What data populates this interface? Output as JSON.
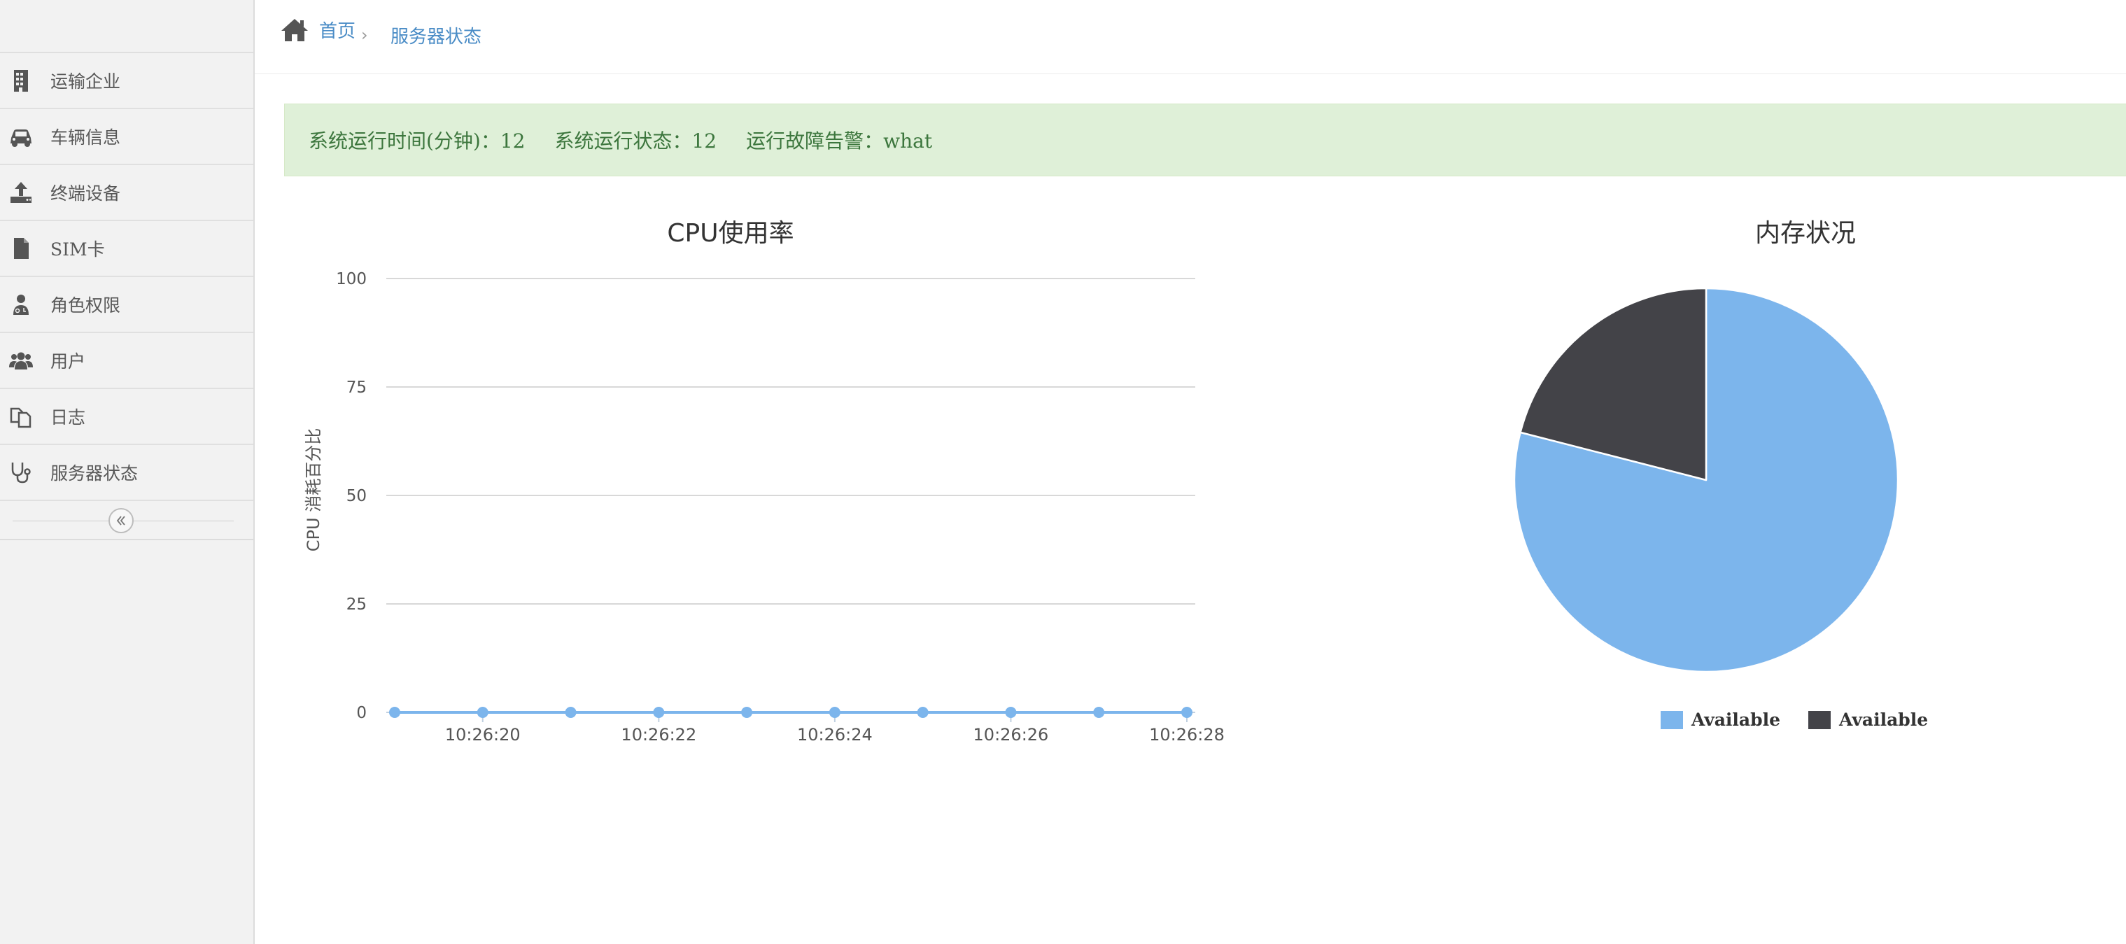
{
  "sidebar": {
    "items": [
      {
        "label": "运输企业",
        "icon": "building-icon"
      },
      {
        "label": "车辆信息",
        "icon": "car-icon"
      },
      {
        "label": "终端设备",
        "icon": "upload-icon"
      },
      {
        "label": "SIM卡",
        "icon": "file-icon"
      },
      {
        "label": "角色权限",
        "icon": "user-md-icon"
      },
      {
        "label": "用户",
        "icon": "users-icon"
      },
      {
        "label": "日志",
        "icon": "copy-icon"
      },
      {
        "label": "服务器状态",
        "icon": "stethoscope-icon"
      }
    ],
    "collapse_icon": "double-chevron-left-icon"
  },
  "breadcrumb": {
    "home": "首页",
    "separator": "›",
    "current": "服务器状态"
  },
  "alert": {
    "uptime": "系统运行时间(分钟)：12",
    "status": "系统运行状态：12",
    "fault": "运行故障告警：what",
    "bg_color": "#dff0d8",
    "text_color": "#3c763d"
  },
  "chart_data": [
    {
      "type": "line",
      "title": "CPU使用率",
      "ylabel": "CPU 消耗百分比",
      "xlabel": "",
      "ylim": [
        0,
        100
      ],
      "yticks": [
        0,
        25,
        50,
        75,
        100
      ],
      "x": [
        "10:26:19",
        "10:26:20",
        "10:26:21",
        "10:26:22",
        "10:26:23",
        "10:26:24",
        "10:26:25",
        "10:26:26",
        "10:26:27",
        "10:26:28"
      ],
      "xtick_labels": [
        "10:26:20",
        "10:26:22",
        "10:26:24",
        "10:26:26",
        "10:26:28"
      ],
      "series": [
        {
          "values": [
            0,
            0,
            0,
            0,
            0,
            0,
            0,
            0,
            0,
            0
          ],
          "color": "#7cb5ec"
        }
      ],
      "grid": true,
      "legend": "none"
    },
    {
      "type": "pie",
      "title": "内存状况",
      "slices": [
        {
          "label": "Available",
          "value": 79,
          "color": "#7cb5ec"
        },
        {
          "label": "Available",
          "value": 21,
          "color": "#434348"
        }
      ],
      "legend": "bottom"
    }
  ]
}
